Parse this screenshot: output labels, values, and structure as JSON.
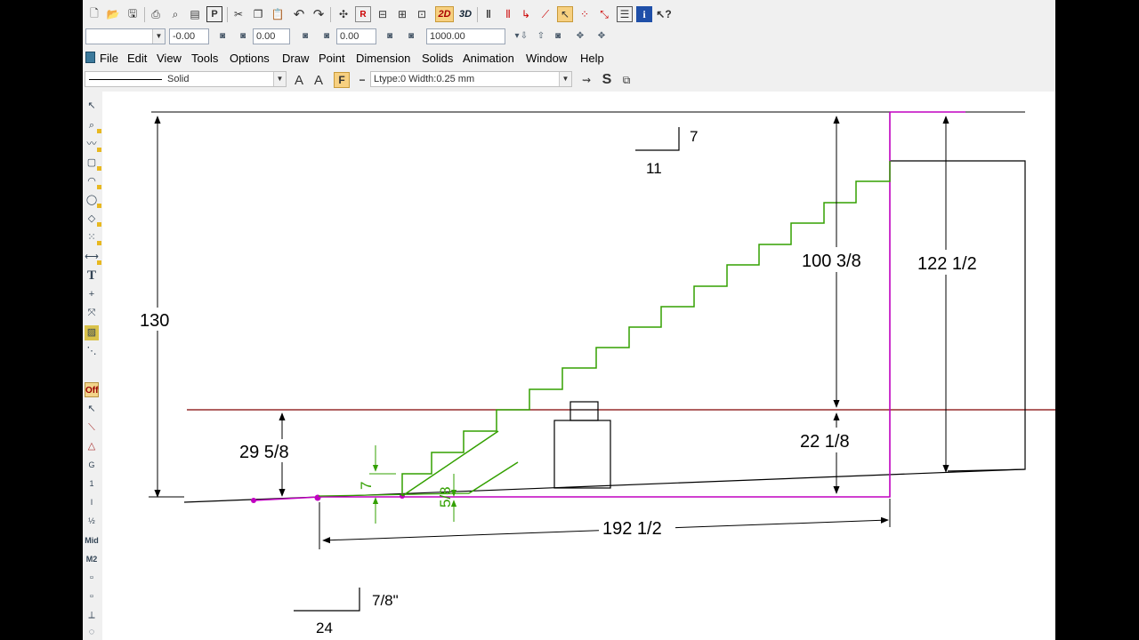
{
  "toolbar_top": {
    "icons": [
      "new-file-icon",
      "open-folder-icon",
      "save-icon",
      "print-icon",
      "print-preview-icon",
      "print-setup-icon",
      "plot-icon",
      "cut-icon",
      "copy-icon",
      "paste-icon",
      "undo-icon",
      "redo-icon",
      "snap-center-icon",
      "render-icon",
      "align-icon",
      "align-left-icon",
      "align-right-icon",
      "align-down-icon"
    ],
    "mode_2d": "2D",
    "mode_3d": "3D",
    "info_label": "i"
  },
  "toolbar_coords": {
    "layer_value": "",
    "x_value": "-0.00",
    "y_value": "0.00",
    "z_value": "0.00",
    "scale_value": "1000.00"
  },
  "menu": {
    "items": [
      "File",
      "Edit",
      "View",
      "Tools",
      "Options",
      "Draw",
      "Point",
      "Dimension",
      "Solids",
      "Animation",
      "Window",
      "Help"
    ]
  },
  "line_toolbar": {
    "line_style": "Solid",
    "ltype_width": "Ltype:0  Width:0.25 mm",
    "text_a_large": "A",
    "text_a_small": "A",
    "fill_label": "F",
    "s_label": "S"
  },
  "left_toolbar": {
    "off_label": "Off",
    "mid_label": "Mid",
    "m2_label": "M2"
  },
  "drawing": {
    "dims": {
      "overall_height": "130",
      "base_rise": "29 5/8",
      "stair_rise": "100 3/8",
      "wall_height": "122 1/2",
      "right_low": "22 1/8",
      "run": "192 1/2",
      "slope_top_rise": "7",
      "slope_top_run": "11",
      "slope_bottom_rise": "7/8\"",
      "slope_bottom_run": "24",
      "small_rise": "7",
      "small_vertical": "5/8"
    },
    "colors": {
      "stairs": "#33a000",
      "magenta": "#c000c0",
      "red_line": "#800000",
      "black": "#000000"
    }
  }
}
